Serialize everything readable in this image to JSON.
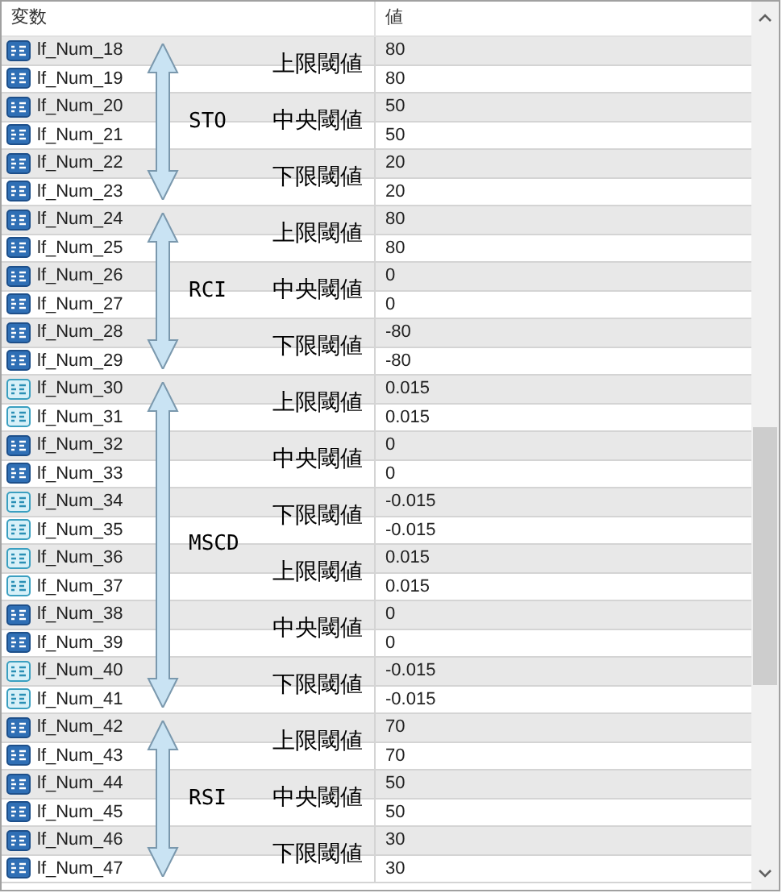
{
  "columns": [
    "変数",
    "値"
  ],
  "groups": [
    {
      "label": "STO",
      "thresholds": [
        "上限閾値",
        "中央閾値",
        "下限閾値"
      ],
      "rows": [
        {
          "name": "lf_Num_18",
          "value": "80",
          "kind": "int"
        },
        {
          "name": "lf_Num_19",
          "value": "80",
          "kind": "int"
        },
        {
          "name": "lf_Num_20",
          "value": "50",
          "kind": "int"
        },
        {
          "name": "lf_Num_21",
          "value": "50",
          "kind": "int"
        },
        {
          "name": "lf_Num_22",
          "value": "20",
          "kind": "int"
        },
        {
          "name": "lf_Num_23",
          "value": "20",
          "kind": "int"
        }
      ]
    },
    {
      "label": "RCI",
      "thresholds": [
        "上限閾値",
        "中央閾値",
        "下限閾値"
      ],
      "rows": [
        {
          "name": "lf_Num_24",
          "value": "80",
          "kind": "int"
        },
        {
          "name": "lf_Num_25",
          "value": "80",
          "kind": "int"
        },
        {
          "name": "lf_Num_26",
          "value": "0",
          "kind": "int"
        },
        {
          "name": "lf_Num_27",
          "value": "0",
          "kind": "int"
        },
        {
          "name": "lf_Num_28",
          "value": "-80",
          "kind": "int"
        },
        {
          "name": "lf_Num_29",
          "value": "-80",
          "kind": "int"
        }
      ]
    },
    {
      "label": "MSCD",
      "thresholds": [
        "上限閾値",
        "中央閾値",
        "下限閾値",
        "上限閾値",
        "中央閾値",
        "下限閾値"
      ],
      "rows": [
        {
          "name": "lf_Num_30",
          "value": "0.015",
          "kind": "double"
        },
        {
          "name": "lf_Num_31",
          "value": "0.015",
          "kind": "double"
        },
        {
          "name": "lf_Num_32",
          "value": "0",
          "kind": "int"
        },
        {
          "name": "lf_Num_33",
          "value": "0",
          "kind": "int"
        },
        {
          "name": "lf_Num_34",
          "value": "-0.015",
          "kind": "double"
        },
        {
          "name": "lf_Num_35",
          "value": "-0.015",
          "kind": "double"
        },
        {
          "name": "lf_Num_36",
          "value": "0.015",
          "kind": "double"
        },
        {
          "name": "lf_Num_37",
          "value": "0.015",
          "kind": "double"
        },
        {
          "name": "lf_Num_38",
          "value": "0",
          "kind": "int"
        },
        {
          "name": "lf_Num_39",
          "value": "0",
          "kind": "int"
        },
        {
          "name": "lf_Num_40",
          "value": "-0.015",
          "kind": "double"
        },
        {
          "name": "lf_Num_41",
          "value": "-0.015",
          "kind": "double"
        }
      ]
    },
    {
      "label": "RSI",
      "thresholds": [
        "上限閾値",
        "中央閾値",
        "下限閾値"
      ],
      "rows": [
        {
          "name": "lf_Num_42",
          "value": "70",
          "kind": "int"
        },
        {
          "name": "lf_Num_43",
          "value": "70",
          "kind": "int"
        },
        {
          "name": "lf_Num_44",
          "value": "50",
          "kind": "int"
        },
        {
          "name": "lf_Num_45",
          "value": "50",
          "kind": "int"
        },
        {
          "name": "lf_Num_46",
          "value": "30",
          "kind": "int"
        },
        {
          "name": "lf_Num_47",
          "value": "30",
          "kind": "int"
        }
      ]
    }
  ]
}
